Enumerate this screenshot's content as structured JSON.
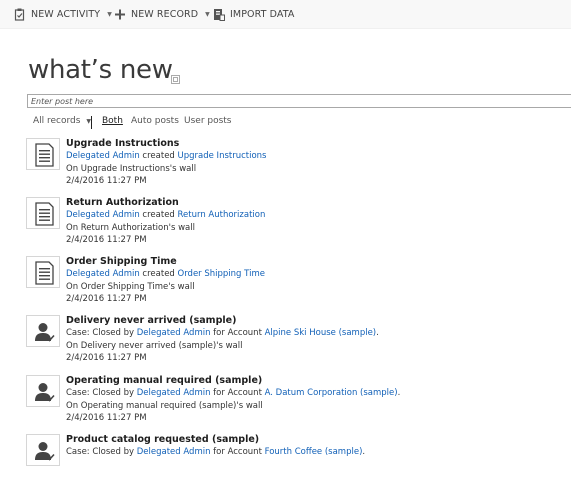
{
  "toolbar": {
    "new_activity": "NEW ACTIVITY",
    "new_record": "NEW RECORD",
    "import_data": "IMPORT DATA"
  },
  "page": {
    "title": "what’s new"
  },
  "post_box": {
    "placeholder": "Enter post here"
  },
  "filters": {
    "all_records": "All records",
    "both": "Both",
    "auto_posts": "Auto posts",
    "user_posts": "User posts"
  },
  "posts": [
    {
      "icon": "document-icon",
      "title": "Upgrade Instructions",
      "author": "Delegated Admin",
      "verb": " created ",
      "record": "Upgrade Instructions",
      "wall": "On Upgrade Instructions's wall",
      "time": "2/4/2016 11:27 PM"
    },
    {
      "icon": "document-icon",
      "title": "Return Authorization",
      "author": "Delegated Admin",
      "verb": " created ",
      "record": "Return Authorization",
      "wall": "On Return Authorization's wall",
      "time": "2/4/2016 11:27 PM"
    },
    {
      "icon": "document-icon",
      "title": "Order Shipping Time",
      "author": "Delegated Admin",
      "verb": " created ",
      "record": "Order Shipping Time",
      "wall": "On Order Shipping Time's wall",
      "time": "2/4/2016 11:27 PM"
    },
    {
      "icon": "case-closed-icon",
      "title": "Delivery never arrived (sample)",
      "prefix": "Case: Closed by ",
      "author": "Delegated Admin",
      "mid": " for Account ",
      "account": "Alpine Ski House (sample)",
      "suffix": ".",
      "wall": "On Delivery never arrived (sample)'s wall",
      "time": "2/4/2016 11:27 PM"
    },
    {
      "icon": "case-closed-icon",
      "title": "Operating manual required (sample)",
      "prefix": "Case: Closed by ",
      "author": "Delegated Admin",
      "mid": " for Account ",
      "account": "A. Datum Corporation (sample)",
      "suffix": ".",
      "wall": "On Operating manual required (sample)'s wall",
      "time": "2/4/2016 11:27 PM"
    },
    {
      "icon": "case-closed-icon",
      "title": "Product catalog requested (sample)",
      "prefix": "Case: Closed by ",
      "author": "Delegated Admin",
      "mid": " for Account ",
      "account": "Fourth Coffee (sample)",
      "suffix": "."
    }
  ]
}
